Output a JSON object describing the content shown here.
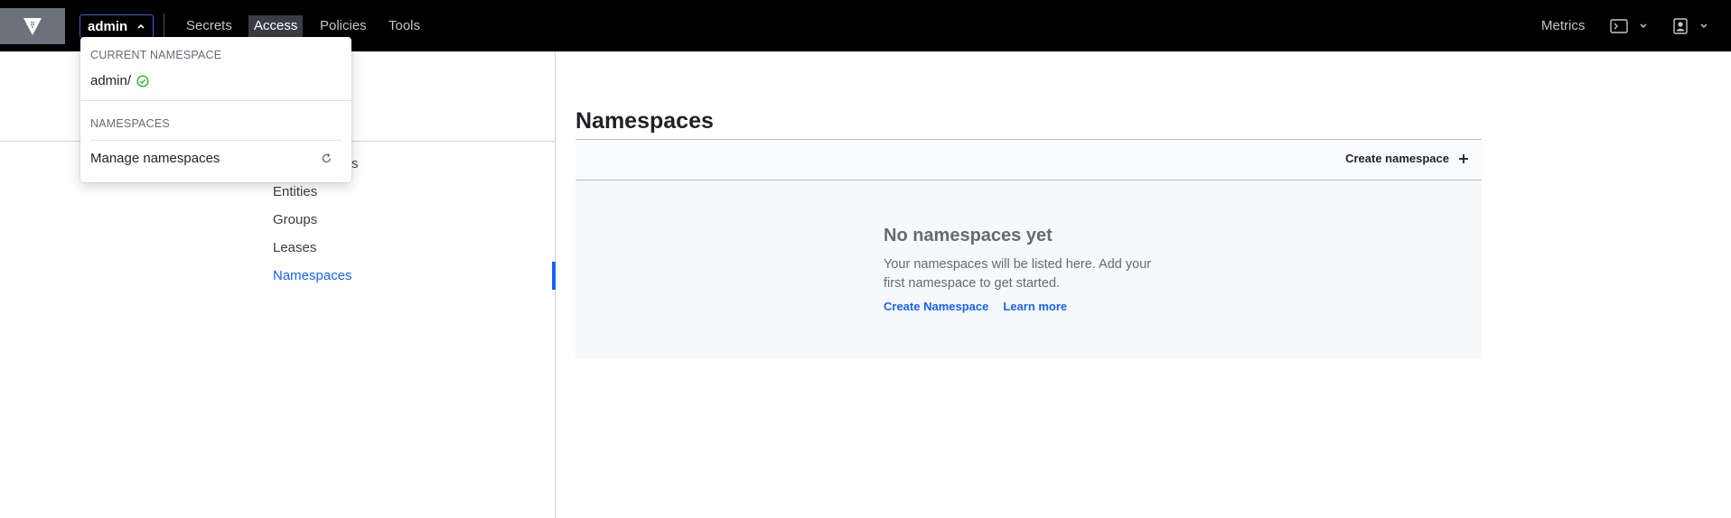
{
  "topnav": {
    "namespace_toggle": "admin",
    "links": [
      "Secrets",
      "Access",
      "Policies",
      "Tools"
    ],
    "active_link": "Access",
    "right_link": "Metrics"
  },
  "sidebar": {
    "partial_item": "s",
    "items": [
      "Entities",
      "Groups",
      "Leases",
      "Namespaces"
    ],
    "active_item": "Namespaces"
  },
  "main": {
    "title": "Namespaces",
    "toolbar_button": "Create namespace",
    "empty_state": {
      "title": "No namespaces yet",
      "body": "Your namespaces will be listed here. Add your first namespace to get started.",
      "primary_link": "Create Namespace",
      "secondary_link": "Learn more"
    }
  },
  "dropdown": {
    "current_label": "CURRENT NAMESPACE",
    "current_value": "admin/",
    "namespaces_label": "NAMESPACES",
    "manage_label": "Manage namespaces"
  },
  "colors": {
    "nav_bg": "#000000",
    "accent": "#1563ff",
    "success": "#2eb039"
  },
  "icons": [
    "logo-icon",
    "chevron-up-icon",
    "terminal-icon",
    "chevron-down-icon",
    "user-icon",
    "plus-icon",
    "check-circle-icon",
    "refresh-icon"
  ]
}
